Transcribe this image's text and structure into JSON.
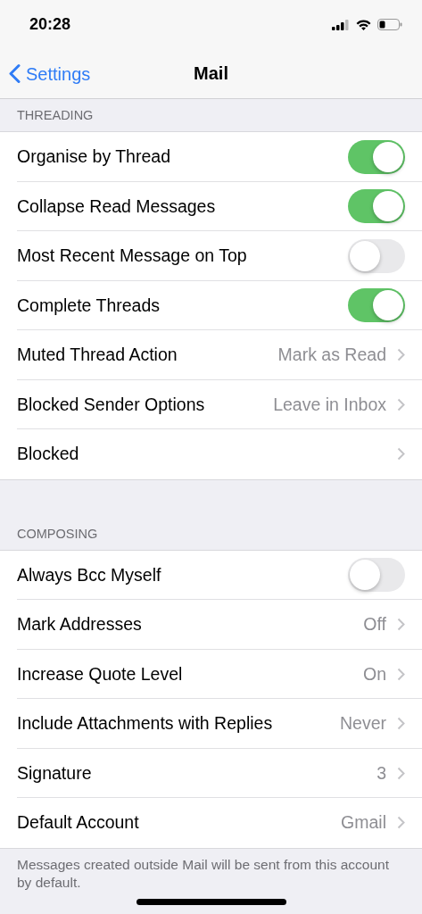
{
  "status_bar": {
    "time": "20:28"
  },
  "nav": {
    "back": "Settings",
    "title": "Mail"
  },
  "sections": [
    {
      "header": "THREADING",
      "rows": [
        {
          "kind": "toggle",
          "label": "Organise by Thread",
          "on": true
        },
        {
          "kind": "toggle",
          "label": "Collapse Read Messages",
          "on": true
        },
        {
          "kind": "toggle",
          "label": "Most Recent Message on Top",
          "on": false
        },
        {
          "kind": "toggle",
          "label": "Complete Threads",
          "on": true
        },
        {
          "kind": "link",
          "label": "Muted Thread Action",
          "value": "Mark as Read"
        },
        {
          "kind": "link",
          "label": "Blocked Sender Options",
          "value": "Leave in Inbox"
        },
        {
          "kind": "link",
          "label": "Blocked"
        }
      ]
    },
    {
      "header": "COMPOSING",
      "rows": [
        {
          "kind": "toggle",
          "label": "Always Bcc Myself",
          "on": false
        },
        {
          "kind": "link",
          "label": "Mark Addresses",
          "value": "Off"
        },
        {
          "kind": "link",
          "label": "Increase Quote Level",
          "value": "On"
        },
        {
          "kind": "link",
          "label": "Include Attachments with Replies",
          "value": "Never"
        },
        {
          "kind": "link",
          "label": "Signature",
          "value": "3"
        },
        {
          "kind": "link",
          "label": "Default Account",
          "value": "Gmail"
        }
      ],
      "footer": "Messages created outside Mail will be sent from this account by default."
    }
  ]
}
